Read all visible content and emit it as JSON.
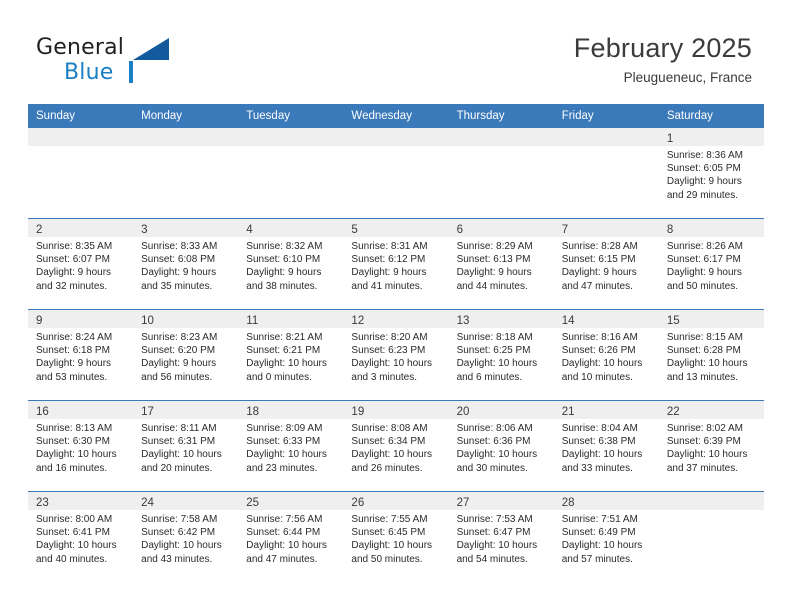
{
  "brand": {
    "name_top": "General",
    "name_bottom": "Blue",
    "triangle_color": "#125a9c",
    "accent_color": "#1b7fc4"
  },
  "header": {
    "title": "February 2025",
    "subtitle": "Pleugueneuc, France"
  },
  "theme": {
    "header_blue": "#3a79ba",
    "day_strip_gray": "#efefef",
    "text_color": "#2b2b2b"
  },
  "calendar": {
    "weekday_headers": [
      "Sunday",
      "Monday",
      "Tuesday",
      "Wednesday",
      "Thursday",
      "Friday",
      "Saturday"
    ],
    "labels": {
      "sunrise": "Sunrise:",
      "sunset": "Sunset:",
      "daylight": "Daylight:"
    },
    "weeks": [
      [
        {
          "day": "",
          "empty": true
        },
        {
          "day": "",
          "empty": true
        },
        {
          "day": "",
          "empty": true
        },
        {
          "day": "",
          "empty": true
        },
        {
          "day": "",
          "empty": true
        },
        {
          "day": "",
          "empty": true
        },
        {
          "day": "1",
          "sunrise": "Sunrise: 8:36 AM",
          "sunset": "Sunset: 6:05 PM",
          "daylight_line1": "Daylight: 9 hours",
          "daylight_line2": "and 29 minutes."
        }
      ],
      [
        {
          "day": "2",
          "sunrise": "Sunrise: 8:35 AM",
          "sunset": "Sunset: 6:07 PM",
          "daylight_line1": "Daylight: 9 hours",
          "daylight_line2": "and 32 minutes."
        },
        {
          "day": "3",
          "sunrise": "Sunrise: 8:33 AM",
          "sunset": "Sunset: 6:08 PM",
          "daylight_line1": "Daylight: 9 hours",
          "daylight_line2": "and 35 minutes."
        },
        {
          "day": "4",
          "sunrise": "Sunrise: 8:32 AM",
          "sunset": "Sunset: 6:10 PM",
          "daylight_line1": "Daylight: 9 hours",
          "daylight_line2": "and 38 minutes."
        },
        {
          "day": "5",
          "sunrise": "Sunrise: 8:31 AM",
          "sunset": "Sunset: 6:12 PM",
          "daylight_line1": "Daylight: 9 hours",
          "daylight_line2": "and 41 minutes."
        },
        {
          "day": "6",
          "sunrise": "Sunrise: 8:29 AM",
          "sunset": "Sunset: 6:13 PM",
          "daylight_line1": "Daylight: 9 hours",
          "daylight_line2": "and 44 minutes."
        },
        {
          "day": "7",
          "sunrise": "Sunrise: 8:28 AM",
          "sunset": "Sunset: 6:15 PM",
          "daylight_line1": "Daylight: 9 hours",
          "daylight_line2": "and 47 minutes."
        },
        {
          "day": "8",
          "sunrise": "Sunrise: 8:26 AM",
          "sunset": "Sunset: 6:17 PM",
          "daylight_line1": "Daylight: 9 hours",
          "daylight_line2": "and 50 minutes."
        }
      ],
      [
        {
          "day": "9",
          "sunrise": "Sunrise: 8:24 AM",
          "sunset": "Sunset: 6:18 PM",
          "daylight_line1": "Daylight: 9 hours",
          "daylight_line2": "and 53 minutes."
        },
        {
          "day": "10",
          "sunrise": "Sunrise: 8:23 AM",
          "sunset": "Sunset: 6:20 PM",
          "daylight_line1": "Daylight: 9 hours",
          "daylight_line2": "and 56 minutes."
        },
        {
          "day": "11",
          "sunrise": "Sunrise: 8:21 AM",
          "sunset": "Sunset: 6:21 PM",
          "daylight_line1": "Daylight: 10 hours",
          "daylight_line2": "and 0 minutes."
        },
        {
          "day": "12",
          "sunrise": "Sunrise: 8:20 AM",
          "sunset": "Sunset: 6:23 PM",
          "daylight_line1": "Daylight: 10 hours",
          "daylight_line2": "and 3 minutes."
        },
        {
          "day": "13",
          "sunrise": "Sunrise: 8:18 AM",
          "sunset": "Sunset: 6:25 PM",
          "daylight_line1": "Daylight: 10 hours",
          "daylight_line2": "and 6 minutes."
        },
        {
          "day": "14",
          "sunrise": "Sunrise: 8:16 AM",
          "sunset": "Sunset: 6:26 PM",
          "daylight_line1": "Daylight: 10 hours",
          "daylight_line2": "and 10 minutes."
        },
        {
          "day": "15",
          "sunrise": "Sunrise: 8:15 AM",
          "sunset": "Sunset: 6:28 PM",
          "daylight_line1": "Daylight: 10 hours",
          "daylight_line2": "and 13 minutes."
        }
      ],
      [
        {
          "day": "16",
          "sunrise": "Sunrise: 8:13 AM",
          "sunset": "Sunset: 6:30 PM",
          "daylight_line1": "Daylight: 10 hours",
          "daylight_line2": "and 16 minutes."
        },
        {
          "day": "17",
          "sunrise": "Sunrise: 8:11 AM",
          "sunset": "Sunset: 6:31 PM",
          "daylight_line1": "Daylight: 10 hours",
          "daylight_line2": "and 20 minutes."
        },
        {
          "day": "18",
          "sunrise": "Sunrise: 8:09 AM",
          "sunset": "Sunset: 6:33 PM",
          "daylight_line1": "Daylight: 10 hours",
          "daylight_line2": "and 23 minutes."
        },
        {
          "day": "19",
          "sunrise": "Sunrise: 8:08 AM",
          "sunset": "Sunset: 6:34 PM",
          "daylight_line1": "Daylight: 10 hours",
          "daylight_line2": "and 26 minutes."
        },
        {
          "day": "20",
          "sunrise": "Sunrise: 8:06 AM",
          "sunset": "Sunset: 6:36 PM",
          "daylight_line1": "Daylight: 10 hours",
          "daylight_line2": "and 30 minutes."
        },
        {
          "day": "21",
          "sunrise": "Sunrise: 8:04 AM",
          "sunset": "Sunset: 6:38 PM",
          "daylight_line1": "Daylight: 10 hours",
          "daylight_line2": "and 33 minutes."
        },
        {
          "day": "22",
          "sunrise": "Sunrise: 8:02 AM",
          "sunset": "Sunset: 6:39 PM",
          "daylight_line1": "Daylight: 10 hours",
          "daylight_line2": "and 37 minutes."
        }
      ],
      [
        {
          "day": "23",
          "sunrise": "Sunrise: 8:00 AM",
          "sunset": "Sunset: 6:41 PM",
          "daylight_line1": "Daylight: 10 hours",
          "daylight_line2": "and 40 minutes."
        },
        {
          "day": "24",
          "sunrise": "Sunrise: 7:58 AM",
          "sunset": "Sunset: 6:42 PM",
          "daylight_line1": "Daylight: 10 hours",
          "daylight_line2": "and 43 minutes."
        },
        {
          "day": "25",
          "sunrise": "Sunrise: 7:56 AM",
          "sunset": "Sunset: 6:44 PM",
          "daylight_line1": "Daylight: 10 hours",
          "daylight_line2": "and 47 minutes."
        },
        {
          "day": "26",
          "sunrise": "Sunrise: 7:55 AM",
          "sunset": "Sunset: 6:45 PM",
          "daylight_line1": "Daylight: 10 hours",
          "daylight_line2": "and 50 minutes."
        },
        {
          "day": "27",
          "sunrise": "Sunrise: 7:53 AM",
          "sunset": "Sunset: 6:47 PM",
          "daylight_line1": "Daylight: 10 hours",
          "daylight_line2": "and 54 minutes."
        },
        {
          "day": "28",
          "sunrise": "Sunrise: 7:51 AM",
          "sunset": "Sunset: 6:49 PM",
          "daylight_line1": "Daylight: 10 hours",
          "daylight_line2": "and 57 minutes."
        },
        {
          "day": "",
          "empty": true
        }
      ]
    ]
  }
}
